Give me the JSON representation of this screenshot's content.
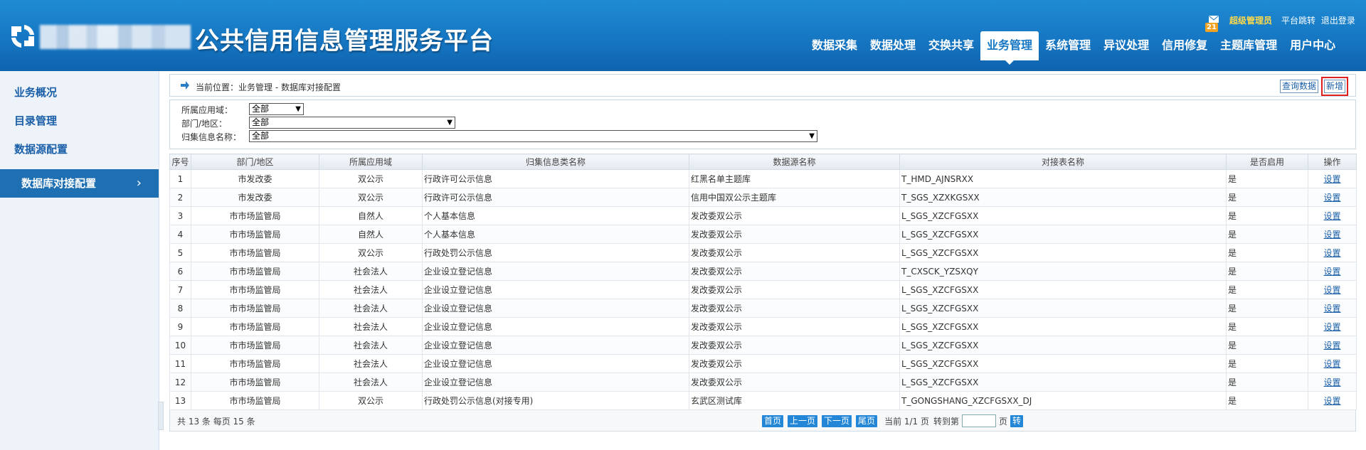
{
  "header": {
    "title": "公共信用信息管理服务平台",
    "mail_badge": "21",
    "user_role": "超级管理员",
    "links": [
      "平台跳转",
      "退出登录"
    ],
    "nav": [
      "数据采集",
      "数据处理",
      "交换共享",
      "业务管理",
      "系统管理",
      "异议处理",
      "信用修复",
      "主题库管理",
      "用户中心"
    ],
    "nav_active_index": 3
  },
  "sidebar": {
    "items": [
      "业务概况",
      "目录管理",
      "数据源配置",
      "数据库对接配置"
    ],
    "active_index": 3
  },
  "breadcrumb": {
    "text": "当前位置：业务管理 - 数据库对接配置",
    "query_button": "查询数据",
    "add_button": "新增"
  },
  "filters": {
    "domain_label": "所属应用域：",
    "domain_value": "全部",
    "dept_label": "部门/地区：",
    "dept_value": "全部",
    "info_label": "归集信息名称：",
    "info_value": "全部"
  },
  "table": {
    "headers": [
      "序号",
      "部门/地区",
      "所属应用域",
      "归集信息类名称",
      "数据源名称",
      "对接表名称",
      "是否启用",
      "操作"
    ],
    "rows": [
      [
        "1",
        "市发改委",
        "双公示",
        "行政许可公示信息",
        "红黑名单主题库",
        "T_HMD_AJNSRXX",
        "是",
        "设置"
      ],
      [
        "2",
        "市发改委",
        "双公示",
        "行政许可公示信息",
        "信用中国双公示主题库",
        "T_SGS_XZXKGSXX",
        "是",
        "设置"
      ],
      [
        "3",
        "市市场监管局",
        "自然人",
        "个人基本信息",
        "发改委双公示",
        "L_SGS_XZCFGSXX",
        "是",
        "设置"
      ],
      [
        "4",
        "市市场监管局",
        "自然人",
        "个人基本信息",
        "发改委双公示",
        "L_SGS_XZCFGSXX",
        "是",
        "设置"
      ],
      [
        "5",
        "市市场监管局",
        "双公示",
        "行政处罚公示信息",
        "发改委双公示",
        "L_SGS_XZCFGSXX",
        "是",
        "设置"
      ],
      [
        "6",
        "市市场监管局",
        "社会法人",
        "企业设立登记信息",
        "发改委双公示",
        "T_CXSCK_YZSXQY",
        "是",
        "设置"
      ],
      [
        "7",
        "市市场监管局",
        "社会法人",
        "企业设立登记信息",
        "发改委双公示",
        "L_SGS_XZCFGSXX",
        "是",
        "设置"
      ],
      [
        "8",
        "市市场监管局",
        "社会法人",
        "企业设立登记信息",
        "发改委双公示",
        "L_SGS_XZCFGSXX",
        "是",
        "设置"
      ],
      [
        "9",
        "市市场监管局",
        "社会法人",
        "企业设立登记信息",
        "发改委双公示",
        "L_SGS_XZCFGSXX",
        "是",
        "设置"
      ],
      [
        "10",
        "市市场监管局",
        "社会法人",
        "企业设立登记信息",
        "发改委双公示",
        "L_SGS_XZCFGSXX",
        "是",
        "设置"
      ],
      [
        "11",
        "市市场监管局",
        "社会法人",
        "企业设立登记信息",
        "发改委双公示",
        "L_SGS_XZCFGSXX",
        "是",
        "设置"
      ],
      [
        "12",
        "市市场监管局",
        "社会法人",
        "企业设立登记信息",
        "发改委双公示",
        "L_SGS_XZCFGSXX",
        "是",
        "设置"
      ],
      [
        "13",
        "市市场监管局",
        "双公示",
        "行政处罚公示信息(对接专用)",
        "玄武区测试库",
        "T_GONGSHANG_XZCFGSXX_DJ",
        "是",
        "设置"
      ]
    ]
  },
  "pager": {
    "total_text": "共 13 条  每页  15   条",
    "first": "首页",
    "prev": "上一页",
    "next": "下一页",
    "last": "尾页",
    "current_text": "当前 1/1 页",
    "goto_label": "转到第",
    "page_unit": "页",
    "go_button": "转"
  },
  "colors": {
    "header_blue": "#1677c3",
    "sidebar_active": "#1f6fb3",
    "link_blue": "#1a5fa8",
    "role_yellow": "#ffd94a",
    "highlight_red": "#e02020"
  }
}
